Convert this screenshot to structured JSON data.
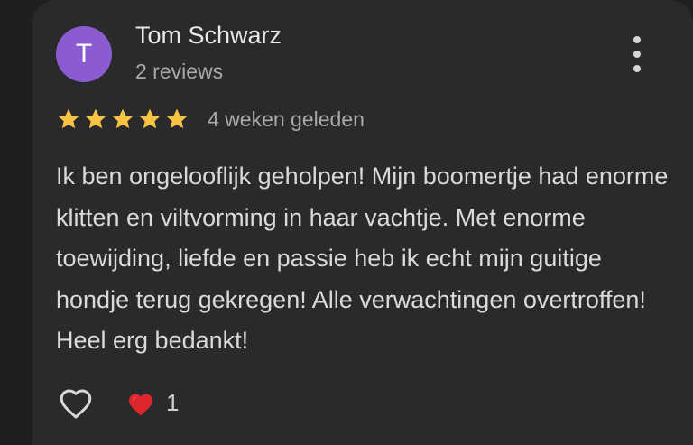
{
  "review": {
    "avatar_letter": "T",
    "author": "Tom Schwarz",
    "review_count": "2 reviews",
    "rating": 5,
    "rating_max": 5,
    "time_ago": "4 weken geleden",
    "text": "Ik ben ongelooflijk geholpen! Mijn boomertje had enorme klitten en viltvorming in haar vachtje. Met enorme toewijding, liefde en passie heb ik echt mijn guitige hondje terug gekregen! Alle verwachtingen overtroffen! Heel erg bedankt!",
    "reaction_count": "1"
  },
  "icons": {
    "menu": "more-vertical-icon",
    "like": "heart-outline-icon",
    "reaction": "red-heart-icon",
    "star": "star-icon"
  },
  "colors": {
    "background": "#1f1f1f",
    "card": "#2a2a2c",
    "avatar": "#8a5bd1",
    "star": "#f6c345",
    "reaction": "#e0262d"
  }
}
